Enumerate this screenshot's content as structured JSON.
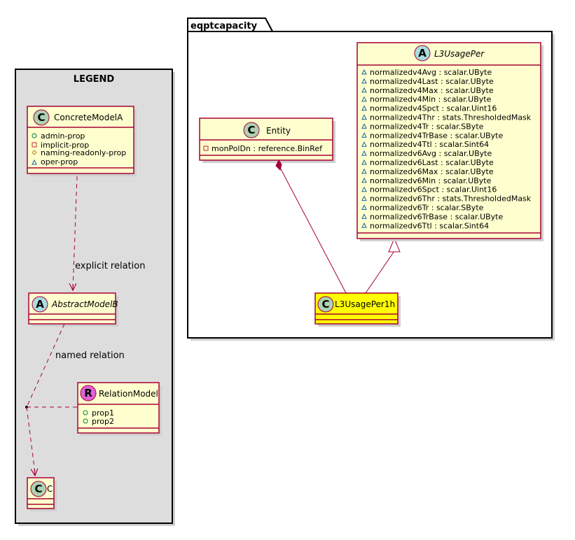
{
  "legend": {
    "title": "LEGEND",
    "concrete_model": {
      "name": "ConcreteModelA",
      "badge": "C",
      "props": [
        {
          "marker": "public",
          "text": "admin-prop"
        },
        {
          "marker": "private",
          "text": "implicit-prop"
        },
        {
          "marker": "protected",
          "text": "naming-readonly-prop"
        },
        {
          "marker": "package",
          "text": "oper-prop"
        }
      ]
    },
    "abstract_model": {
      "name": "AbstractModelB",
      "badge": "A"
    },
    "relation_model": {
      "name": "RelationModel",
      "badge": "R",
      "props": [
        {
          "marker": "public",
          "text": "prop1"
        },
        {
          "marker": "public",
          "text": "prop2"
        }
      ]
    },
    "class_c": {
      "name": "C",
      "badge": "C"
    },
    "explicit_relation_label": "explicit relation",
    "named_relation_label": "named relation"
  },
  "package": {
    "name": "eqptcapacity",
    "entity": {
      "name": "Entity",
      "badge": "C",
      "props": [
        {
          "marker": "private",
          "text": "monPolDn : reference.BinRef"
        }
      ]
    },
    "l3usageper": {
      "name": "L3UsagePer",
      "badge": "A",
      "props": [
        {
          "marker": "package",
          "text": "normalizedv4Avg : scalar.UByte"
        },
        {
          "marker": "package",
          "text": "normalizedv4Last : scalar.UByte"
        },
        {
          "marker": "package",
          "text": "normalizedv4Max : scalar.UByte"
        },
        {
          "marker": "package",
          "text": "normalizedv4Min : scalar.UByte"
        },
        {
          "marker": "package",
          "text": "normalizedv4Spct : scalar.Uint16"
        },
        {
          "marker": "package",
          "text": "normalizedv4Thr : stats.ThresholdedMask"
        },
        {
          "marker": "package",
          "text": "normalizedv4Tr : scalar.SByte"
        },
        {
          "marker": "package",
          "text": "normalizedv4TrBase : scalar.UByte"
        },
        {
          "marker": "package",
          "text": "normalizedv4Ttl : scalar.Sint64"
        },
        {
          "marker": "package",
          "text": "normalizedv6Avg : scalar.UByte"
        },
        {
          "marker": "package",
          "text": "normalizedv6Last : scalar.UByte"
        },
        {
          "marker": "package",
          "text": "normalizedv6Max : scalar.UByte"
        },
        {
          "marker": "package",
          "text": "normalizedv6Min : scalar.UByte"
        },
        {
          "marker": "package",
          "text": "normalizedv6Spct : scalar.Uint16"
        },
        {
          "marker": "package",
          "text": "normalizedv6Thr : stats.ThresholdedMask"
        },
        {
          "marker": "package",
          "text": "normalizedv6Tr : scalar.SByte"
        },
        {
          "marker": "package",
          "text": "normalizedv6TrBase : scalar.UByte"
        },
        {
          "marker": "package",
          "text": "normalizedv6Ttl : scalar.Sint64"
        }
      ]
    },
    "l3usageper1h": {
      "name": "L3UsagePer1h",
      "badge": "C",
      "highlight_color": "#FFFF00"
    }
  },
  "colors": {
    "class_fill": "#FEFECE",
    "border": "#A80036",
    "legend_bg": "#DDDDDD",
    "highlight": "#FFFF00"
  }
}
